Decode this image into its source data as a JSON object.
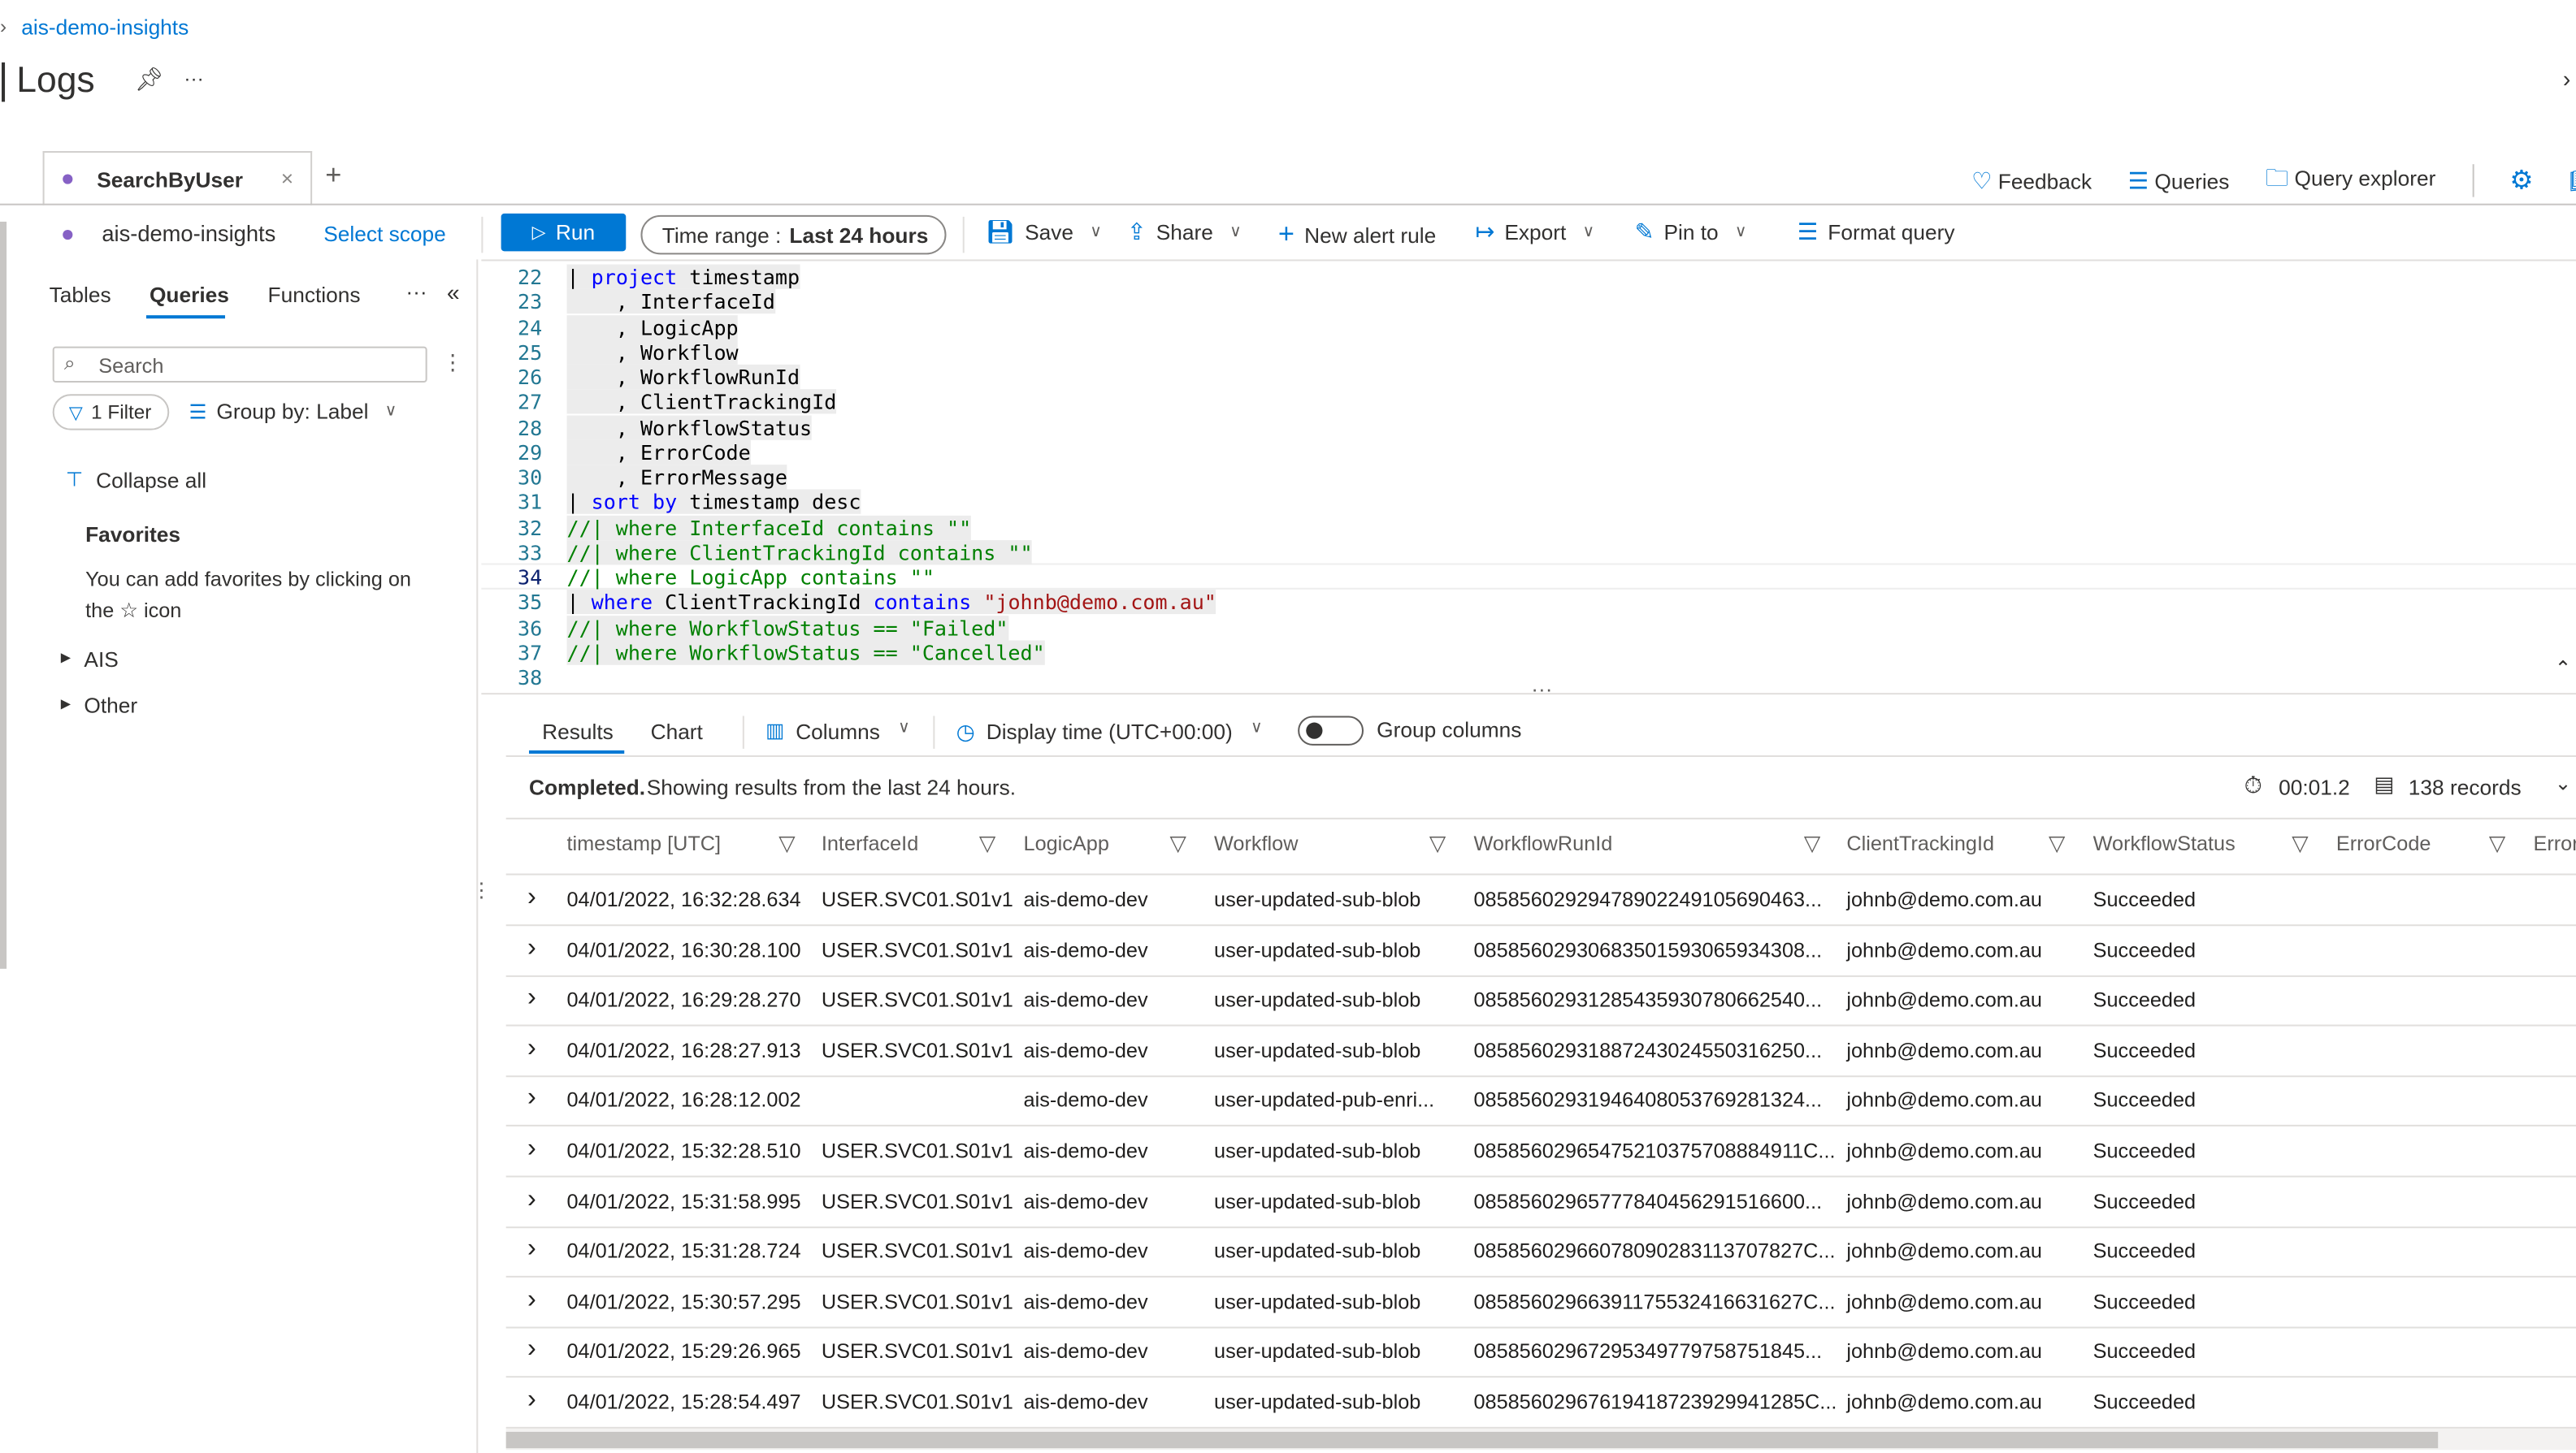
{
  "breadcrumb": {
    "item": "ais-demo-insights"
  },
  "page": {
    "title": "Logs",
    "more": "···"
  },
  "tabs": {
    "active": "SearchByUser",
    "close": "×",
    "add": "+"
  },
  "header_actions": {
    "feedback": "Feedback",
    "queries": "Queries",
    "query_explorer": "Query explorer"
  },
  "toolbar": {
    "scope": "ais-demo-insights",
    "select_scope": "Select scope",
    "run": "Run",
    "time_range_label": "Time range :",
    "time_range_value": "Last 24 hours",
    "save": "Save",
    "share": "Share",
    "new_alert": "New alert rule",
    "export": "Export",
    "pin_to": "Pin to",
    "format_query": "Format query"
  },
  "sidebar": {
    "tabs": [
      "Tables",
      "Queries",
      "Functions"
    ],
    "more": "···",
    "search_placeholder": "Search",
    "filter": "1 Filter",
    "group_by": "Group by: Label",
    "collapse_all": "Collapse all",
    "favorites_title": "Favorites",
    "favorites_text_1": "You can add favorites by clicking on",
    "favorites_text_2": "the ☆ icon",
    "groups": [
      "AIS",
      "Other"
    ]
  },
  "editor": {
    "lines": [
      {
        "n": "22",
        "t": [
          [
            "p",
            "| "
          ],
          [
            "k",
            "project"
          ],
          [
            "p",
            " timestamp"
          ]
        ]
      },
      {
        "n": "23",
        "t": [
          [
            "p",
            "    , InterfaceId"
          ]
        ]
      },
      {
        "n": "24",
        "t": [
          [
            "p",
            "    , LogicApp"
          ]
        ]
      },
      {
        "n": "25",
        "t": [
          [
            "p",
            "    , Workflow"
          ]
        ]
      },
      {
        "n": "26",
        "t": [
          [
            "p",
            "    , WorkflowRunId"
          ]
        ]
      },
      {
        "n": "27",
        "t": [
          [
            "p",
            "    , ClientTrackingId"
          ]
        ]
      },
      {
        "n": "28",
        "t": [
          [
            "p",
            "    , WorkflowStatus"
          ]
        ]
      },
      {
        "n": "29",
        "t": [
          [
            "p",
            "    , ErrorCode"
          ]
        ]
      },
      {
        "n": "30",
        "t": [
          [
            "p",
            "    , ErrorMessage"
          ]
        ]
      },
      {
        "n": "31",
        "t": [
          [
            "p",
            "| "
          ],
          [
            "k",
            "sort by"
          ],
          [
            "p",
            " timestamp desc"
          ]
        ]
      },
      {
        "n": "32",
        "t": [
          [
            "c",
            "//| where InterfaceId contains \"\""
          ]
        ]
      },
      {
        "n": "33",
        "t": [
          [
            "c",
            "//| where ClientTrackingId contains \"\""
          ]
        ]
      },
      {
        "n": "34",
        "t": [
          [
            "c",
            "//| where LogicApp contains \"\""
          ]
        ]
      },
      {
        "n": "35",
        "t": [
          [
            "p",
            "| "
          ],
          [
            "k",
            "where"
          ],
          [
            "p",
            " ClientTrackingId "
          ],
          [
            "k",
            "contains"
          ],
          [
            "s",
            " \"johnb@demo.com.au\""
          ]
        ]
      },
      {
        "n": "36",
        "t": [
          [
            "c",
            "//| where WorkflowStatus == \"Failed\""
          ]
        ]
      },
      {
        "n": "37",
        "t": [
          [
            "c",
            "//| where WorkflowStatus == \"Cancelled\""
          ]
        ]
      },
      {
        "n": "38",
        "t": []
      }
    ]
  },
  "results": {
    "tabs": [
      "Results",
      "Chart"
    ],
    "columns_btn": "Columns",
    "display_time": "Display time (UTC+00:00)",
    "group_columns": "Group columns",
    "group_columns_on": false,
    "status_bold": "Completed.",
    "status_text": " Showing results from the last 24 hours.",
    "duration": "00:01.2",
    "records": "138 records",
    "headers": [
      "timestamp [UTC]",
      "InterfaceId",
      "LogicApp",
      "Workflow",
      "WorkflowRunId",
      "ClientTrackingId",
      "WorkflowStatus",
      "ErrorCode",
      "Error"
    ],
    "rows": [
      [
        "04/01/2022, 16:32:28.634",
        "USER.SVC01.S01v1",
        "ais-demo-dev",
        "user-updated-sub-blob",
        "08585602929478902249105690463...",
        "johnb@demo.com.au",
        "Succeeded"
      ],
      [
        "04/01/2022, 16:30:28.100",
        "USER.SVC01.S01v1",
        "ais-demo-dev",
        "user-updated-sub-blob",
        "08585602930683501593065934308...",
        "johnb@demo.com.au",
        "Succeeded"
      ],
      [
        "04/01/2022, 16:29:28.270",
        "USER.SVC01.S01v1",
        "ais-demo-dev",
        "user-updated-sub-blob",
        "08585602931285435930780662540...",
        "johnb@demo.com.au",
        "Succeeded"
      ],
      [
        "04/01/2022, 16:28:27.913",
        "USER.SVC01.S01v1",
        "ais-demo-dev",
        "user-updated-sub-blob",
        "08585602931887243024550316250...",
        "johnb@demo.com.au",
        "Succeeded"
      ],
      [
        "04/01/2022, 16:28:12.002",
        "",
        "ais-demo-dev",
        "user-updated-pub-enri...",
        "08585602931946408053769281324...",
        "johnb@demo.com.au",
        "Succeeded"
      ],
      [
        "04/01/2022, 15:32:28.510",
        "USER.SVC01.S01v1",
        "ais-demo-dev",
        "user-updated-sub-blob",
        "08585602965475210375708884911C...",
        "johnb@demo.com.au",
        "Succeeded"
      ],
      [
        "04/01/2022, 15:31:58.995",
        "USER.SVC01.S01v1",
        "ais-demo-dev",
        "user-updated-sub-blob",
        "08585602965777840456291516600...",
        "johnb@demo.com.au",
        "Succeeded"
      ],
      [
        "04/01/2022, 15:31:28.724",
        "USER.SVC01.S01v1",
        "ais-demo-dev",
        "user-updated-sub-blob",
        "08585602966078090283113707827C...",
        "johnb@demo.com.au",
        "Succeeded"
      ],
      [
        "04/01/2022, 15:30:57.295",
        "USER.SVC01.S01v1",
        "ais-demo-dev",
        "user-updated-sub-blob",
        "08585602966391175532416631627C...",
        "johnb@demo.com.au",
        "Succeeded"
      ],
      [
        "04/01/2022, 15:29:26.965",
        "USER.SVC01.S01v1",
        "ais-demo-dev",
        "user-updated-sub-blob",
        "08585602967295349779758751845...",
        "johnb@demo.com.au",
        "Succeeded"
      ],
      [
        "04/01/2022, 15:28:54.497",
        "USER.SVC01.S01v1",
        "ais-demo-dev",
        "user-updated-sub-blob",
        "08585602967619418723929941285C...",
        "johnb@demo.com.au",
        "Succeeded"
      ]
    ]
  },
  "colors": {
    "accent": "#0078d4",
    "keyword": "#0000ff",
    "comment": "#008000",
    "string": "#a31515",
    "line_number": "#237893"
  }
}
